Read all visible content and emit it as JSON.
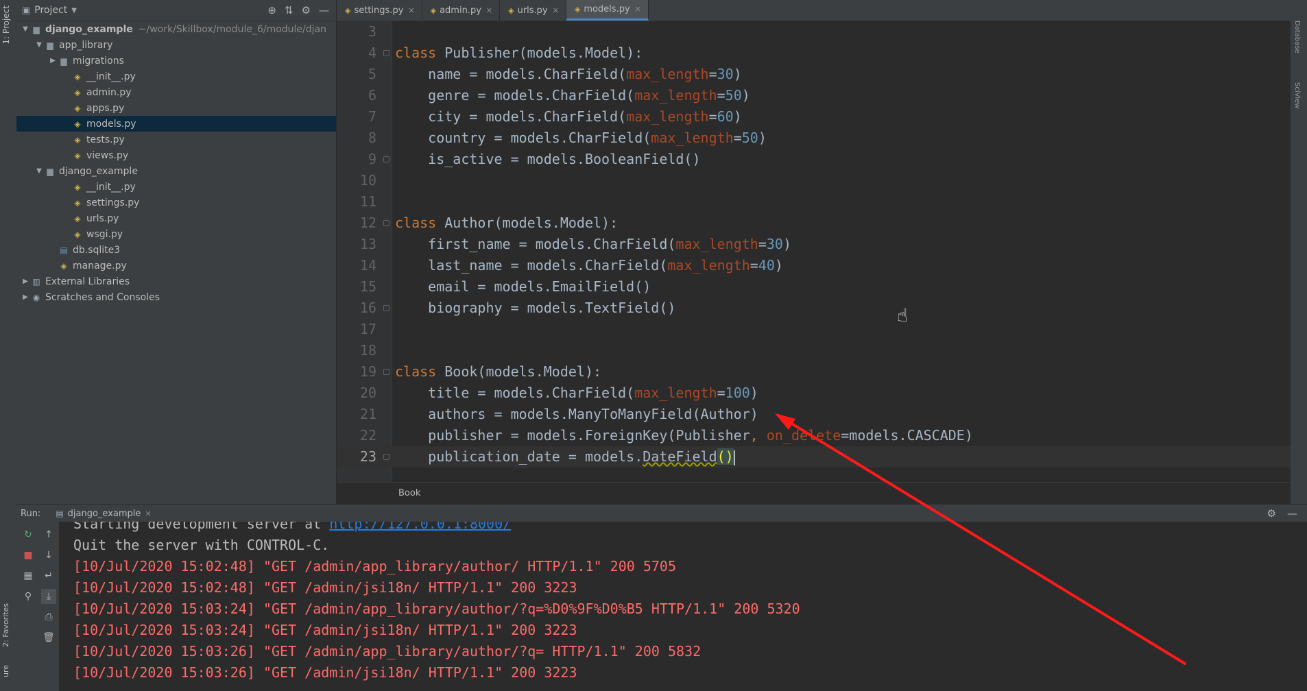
{
  "left_stripe": {
    "project_tab": "1: Project",
    "favorites_tab": "2: Favorites",
    "structure_tab": "ure"
  },
  "right_stripe": {
    "database_tab": "Database",
    "sciview_tab": "SciView"
  },
  "project_panel": {
    "title": "Project",
    "tree": [
      {
        "label": "django_example",
        "path": "~/work/Skillbox/module_6/module/djan",
        "depth": 0,
        "arrow": "▼",
        "icon": "folder-icon",
        "bold": true
      },
      {
        "label": "app_library",
        "depth": 1,
        "arrow": "▼",
        "icon": "folder-icon"
      },
      {
        "label": "migrations",
        "depth": 2,
        "arrow": "▶",
        "icon": "folder-icon"
      },
      {
        "label": "__init__.py",
        "depth": 3,
        "arrow": "",
        "icon": "python-file-icon"
      },
      {
        "label": "admin.py",
        "depth": 3,
        "arrow": "",
        "icon": "python-file-icon"
      },
      {
        "label": "apps.py",
        "depth": 3,
        "arrow": "",
        "icon": "python-file-icon"
      },
      {
        "label": "models.py",
        "depth": 3,
        "arrow": "",
        "icon": "python-file-icon",
        "selected": true
      },
      {
        "label": "tests.py",
        "depth": 3,
        "arrow": "",
        "icon": "python-file-icon"
      },
      {
        "label": "views.py",
        "depth": 3,
        "arrow": "",
        "icon": "python-file-icon"
      },
      {
        "label": "django_example",
        "depth": 1,
        "arrow": "▼",
        "icon": "folder-icon"
      },
      {
        "label": "__init__.py",
        "depth": 3,
        "arrow": "",
        "icon": "python-file-icon"
      },
      {
        "label": "settings.py",
        "depth": 3,
        "arrow": "",
        "icon": "python-file-icon"
      },
      {
        "label": "urls.py",
        "depth": 3,
        "arrow": "",
        "icon": "python-file-icon"
      },
      {
        "label": "wsgi.py",
        "depth": 3,
        "arrow": "",
        "icon": "python-file-icon"
      },
      {
        "label": "db.sqlite3",
        "depth": 2,
        "arrow": "",
        "icon": "database-icon"
      },
      {
        "label": "manage.py",
        "depth": 2,
        "arrow": "",
        "icon": "python-file-icon"
      },
      {
        "label": "External Libraries",
        "depth": 0,
        "arrow": "▶",
        "icon": "library-icon"
      },
      {
        "label": "Scratches and Consoles",
        "depth": 0,
        "arrow": "▶",
        "icon": "scratches-icon"
      }
    ]
  },
  "tabs": [
    {
      "label": "settings.py",
      "active": false
    },
    {
      "label": "admin.py",
      "active": false
    },
    {
      "label": "urls.py",
      "active": false
    },
    {
      "label": "models.py",
      "active": true
    }
  ],
  "editor": {
    "current_line": 23,
    "lines": [
      {
        "n": "3",
        "fold": false,
        "tokens": []
      },
      {
        "n": "4",
        "fold": true,
        "tokens": [
          [
            "kw",
            "class "
          ],
          [
            "cls",
            "Publisher(models.Model):"
          ]
        ]
      },
      {
        "n": "5",
        "fold": false,
        "tokens": [
          [
            "t",
            "    name = models.CharField("
          ],
          [
            "kwarg",
            "max_length"
          ],
          [
            "t",
            "="
          ],
          [
            "num",
            "30"
          ],
          [
            "t",
            ")"
          ]
        ]
      },
      {
        "n": "6",
        "fold": false,
        "tokens": [
          [
            "t",
            "    genre = models.CharField("
          ],
          [
            "kwarg",
            "max_length"
          ],
          [
            "t",
            "="
          ],
          [
            "num",
            "50"
          ],
          [
            "t",
            ")"
          ]
        ]
      },
      {
        "n": "7",
        "fold": false,
        "tokens": [
          [
            "t",
            "    city = models.CharField("
          ],
          [
            "kwarg",
            "max_length"
          ],
          [
            "t",
            "="
          ],
          [
            "num",
            "60"
          ],
          [
            "t",
            ")"
          ]
        ]
      },
      {
        "n": "8",
        "fold": false,
        "tokens": [
          [
            "t",
            "    country = models.CharField("
          ],
          [
            "kwarg",
            "max_length"
          ],
          [
            "t",
            "="
          ],
          [
            "num",
            "50"
          ],
          [
            "t",
            ")"
          ]
        ]
      },
      {
        "n": "9",
        "fold": true,
        "tokens": [
          [
            "t",
            "    is_active = models.BooleanField()"
          ]
        ]
      },
      {
        "n": "10",
        "fold": false,
        "tokens": []
      },
      {
        "n": "11",
        "fold": false,
        "tokens": []
      },
      {
        "n": "12",
        "fold": true,
        "tokens": [
          [
            "kw",
            "class "
          ],
          [
            "cls",
            "Author(models.Model):"
          ]
        ]
      },
      {
        "n": "13",
        "fold": false,
        "tokens": [
          [
            "t",
            "    first_name = models.CharField("
          ],
          [
            "kwarg",
            "max_length"
          ],
          [
            "t",
            "="
          ],
          [
            "num",
            "30"
          ],
          [
            "t",
            ")"
          ]
        ]
      },
      {
        "n": "14",
        "fold": false,
        "tokens": [
          [
            "t",
            "    last_name = models.CharField("
          ],
          [
            "kwarg",
            "max_length"
          ],
          [
            "t",
            "="
          ],
          [
            "num",
            "40"
          ],
          [
            "t",
            ")"
          ]
        ]
      },
      {
        "n": "15",
        "fold": false,
        "tokens": [
          [
            "t",
            "    email = models.EmailField()"
          ]
        ]
      },
      {
        "n": "16",
        "fold": true,
        "tokens": [
          [
            "t",
            "    biography = models.TextField()"
          ]
        ]
      },
      {
        "n": "17",
        "fold": false,
        "tokens": []
      },
      {
        "n": "18",
        "fold": false,
        "tokens": []
      },
      {
        "n": "19",
        "fold": true,
        "tokens": [
          [
            "kw",
            "class "
          ],
          [
            "cls",
            "Book(models.Model):"
          ]
        ]
      },
      {
        "n": "20",
        "fold": false,
        "tokens": [
          [
            "t",
            "    title = models.CharField("
          ],
          [
            "kwarg",
            "max_length"
          ],
          [
            "t",
            "="
          ],
          [
            "num",
            "100"
          ],
          [
            "t",
            ")"
          ]
        ]
      },
      {
        "n": "21",
        "fold": false,
        "tokens": [
          [
            "t",
            "    authors = models.ManyToManyField(Author)"
          ]
        ]
      },
      {
        "n": "22",
        "fold": false,
        "tokens": [
          [
            "t",
            "    publisher = models.ForeignKey(Publisher"
          ],
          [
            "kw",
            ", "
          ],
          [
            "kwarg",
            "on_delete"
          ],
          [
            "t",
            "=models.CASCADE)"
          ]
        ]
      },
      {
        "n": "23",
        "fold": true,
        "tokens": [
          [
            "t",
            "    publication_date = models."
          ],
          [
            "sq",
            "DateField"
          ],
          [
            "ph",
            "()"
          ],
          [
            "caret",
            ""
          ]
        ]
      }
    ]
  },
  "breadcrumb": {
    "label": "Book"
  },
  "run_panel": {
    "label": "Run:",
    "tab_label": "django_example",
    "console": [
      {
        "cls": "c-info",
        "text": "Starting development server at ",
        "link": "http://127.0.0.1:8000/"
      },
      {
        "cls": "c-info",
        "text": "Quit the server with CONTROL-C."
      },
      {
        "cls": "c-log",
        "text": "[10/Jul/2020 15:02:48] \"GET /admin/app_library/author/ HTTP/1.1\" 200 5705"
      },
      {
        "cls": "c-log",
        "text": "[10/Jul/2020 15:02:48] \"GET /admin/jsi18n/ HTTP/1.1\" 200 3223"
      },
      {
        "cls": "c-log",
        "text": "[10/Jul/2020 15:03:24] \"GET /admin/app_library/author/?q=%D0%9F%D0%B5 HTTP/1.1\" 200 5320"
      },
      {
        "cls": "c-log",
        "text": "[10/Jul/2020 15:03:24] \"GET /admin/jsi18n/ HTTP/1.1\" 200 3223"
      },
      {
        "cls": "c-log",
        "text": "[10/Jul/2020 15:03:26] \"GET /admin/app_library/author/?q= HTTP/1.1\" 200 5832"
      },
      {
        "cls": "c-log",
        "text": "[10/Jul/2020 15:03:26] \"GET /admin/jsi18n/ HTTP/1.1\" 200 3223"
      }
    ]
  },
  "colors": {
    "annotation_arrow": "#ff1a1a",
    "keyword": "#cc7832",
    "kwarg": "#aa4926",
    "number": "#6897bb",
    "log_text": "#ff6b68"
  }
}
